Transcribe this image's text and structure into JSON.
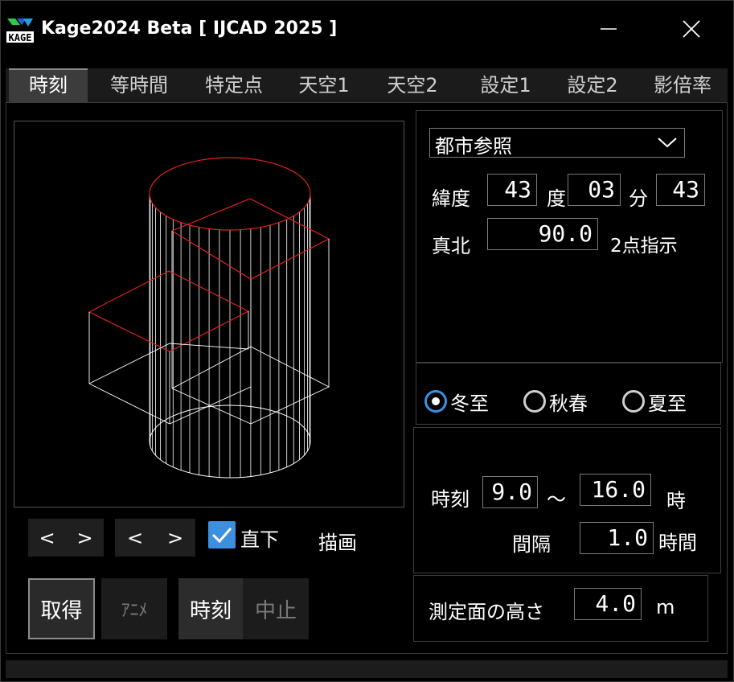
{
  "window": {
    "title": "Kage2024 Beta [ IJCAD 2025 ]",
    "icon_text": "KAGE"
  },
  "tabs": [
    {
      "label": "時刻",
      "active": true
    },
    {
      "label": "等時間",
      "active": false
    },
    {
      "label": "特定点",
      "active": false
    },
    {
      "label": "天空1",
      "active": false
    },
    {
      "label": "天空2",
      "active": false
    },
    {
      "label": "設定1",
      "active": false
    },
    {
      "label": "設定2",
      "active": false
    },
    {
      "label": "影倍率",
      "active": false
    }
  ],
  "location": {
    "city_select": "都市参照",
    "latitude_label": "緯度",
    "degree_value": "43",
    "degree_unit": "度",
    "minute_value": "03",
    "minute_unit": "分",
    "second_value": "43",
    "true_north_label": "真北",
    "true_north_value": "90.0",
    "two_point_label": "2点指示"
  },
  "season": {
    "options": [
      {
        "label": "冬至",
        "selected": true
      },
      {
        "label": "秋春",
        "selected": false
      },
      {
        "label": "夏至",
        "selected": false
      }
    ]
  },
  "time": {
    "time_label": "時刻",
    "start": "9.0",
    "tilde": "～",
    "end": "16.0",
    "hour_unit": "時",
    "interval_label": "間隔",
    "interval_value": "1.0",
    "interval_unit": "時間"
  },
  "height": {
    "label": "測定面の高さ",
    "value": "4.0",
    "unit": "m"
  },
  "view_controls": {
    "prev1": "<",
    "next1": ">",
    "prev2": "<",
    "next2": ">",
    "directly_below_label": "直下",
    "directly_below_checked": true,
    "draw_label": "描画"
  },
  "buttons": {
    "acquire": "取得",
    "anime": "ｱﾆﾒ",
    "time": "時刻",
    "stop": "中止"
  },
  "colors": {
    "accent": "#3d8fe0",
    "roof": "#e02020",
    "wire": "#ffffff"
  }
}
